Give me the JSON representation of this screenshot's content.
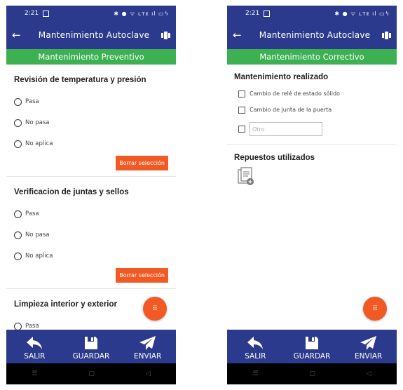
{
  "left": {
    "status": {
      "time": "2:21",
      "icons": "✱ ● ᯤ ʟᴛᴇ ıl ▭ϟ"
    },
    "appbar": {
      "back": "←",
      "title": "Mantenimiento Autoclave"
    },
    "banner": "Mantenimiento Preventivo",
    "questions": [
      {
        "title": "Revisión de temperatura y presión",
        "options": [
          "Pasa",
          "No pasa",
          "No aplica"
        ],
        "clear_label": "Borrar selección"
      },
      {
        "title": "Verificacion de juntas y sellos",
        "options": [
          "Pasa",
          "No pasa",
          "No aplica"
        ],
        "clear_label": "Borrar selección"
      },
      {
        "title": "Limpieza interior y exterior",
        "options": [
          "Pasa"
        ]
      }
    ],
    "fab_icon": "⠿"
  },
  "right": {
    "status": {
      "time": "2:21",
      "icons": "✱ ● ᯤ ʟᴛᴇ ıl ▭ϟ"
    },
    "appbar": {
      "back": "←",
      "title": "Mantenimiento Autoclave"
    },
    "banner": "Mantenimiento Correctivo",
    "section1_title": "Mantenimiento realizado",
    "checks": [
      "Cambio de relé de estado sólido",
      "Cambio de junta de la puerta"
    ],
    "otro_placeholder": "Otro",
    "section2_title": "Repuestos utilizados",
    "fab_icon": "⠿"
  },
  "bottom": {
    "exit": "SALIR",
    "save": "GUARDAR",
    "send": "ENVIAR"
  },
  "nav": {
    "menu": "☰",
    "home": "▢",
    "back": "◁"
  },
  "colors": {
    "primary": "#2b3a8c",
    "green": "#3db152",
    "accent": "#f15a24"
  }
}
